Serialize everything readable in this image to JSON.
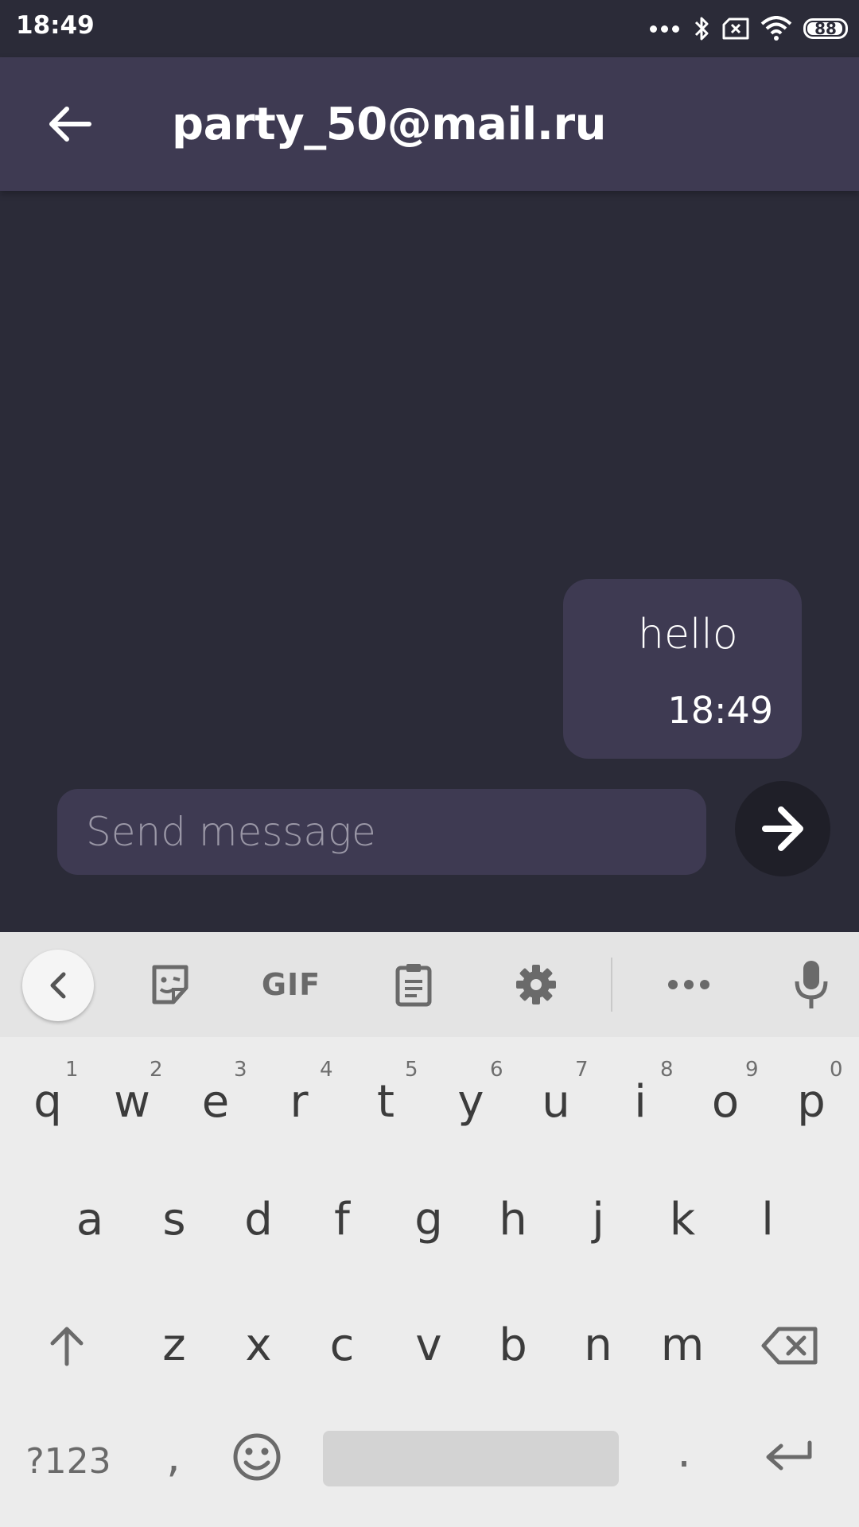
{
  "status_bar": {
    "time": "18:49",
    "battery": "88",
    "icons": [
      "more-dots-icon",
      "bluetooth-icon",
      "sim-blocked-icon",
      "wifi-icon",
      "battery-icon"
    ]
  },
  "app_bar": {
    "title": "party_50@mail.ru",
    "back_icon": "arrow-left-icon"
  },
  "messages": [
    {
      "text": "hello",
      "time": "18:49",
      "outgoing": true
    }
  ],
  "composer": {
    "placeholder": "Send message",
    "value": "",
    "send_icon": "arrow-right-icon"
  },
  "keyboard": {
    "toolbar": {
      "items": [
        "collapse-icon",
        "sticker-icon",
        "GIF",
        "clipboard-icon",
        "settings-gear-icon",
        "more-dots-icon",
        "microphone-icon"
      ],
      "gif_label": "GIF"
    },
    "row1": [
      "q",
      "w",
      "e",
      "r",
      "t",
      "y",
      "u",
      "i",
      "o",
      "p"
    ],
    "row1_hints": [
      "1",
      "2",
      "3",
      "4",
      "5",
      "6",
      "7",
      "8",
      "9",
      "0"
    ],
    "row2": [
      "a",
      "s",
      "d",
      "f",
      "g",
      "h",
      "j",
      "k",
      "l"
    ],
    "row3": [
      "z",
      "x",
      "c",
      "v",
      "b",
      "n",
      "m"
    ],
    "symbols_label": "?123",
    "comma": ",",
    "period": "."
  },
  "colors": {
    "background": "#2b2b38",
    "app_bar": "#3e3a52",
    "bubble": "#3e3a52",
    "input": "#3e3a52",
    "send_button": "#1f1f28",
    "keyboard": "#ececec"
  }
}
